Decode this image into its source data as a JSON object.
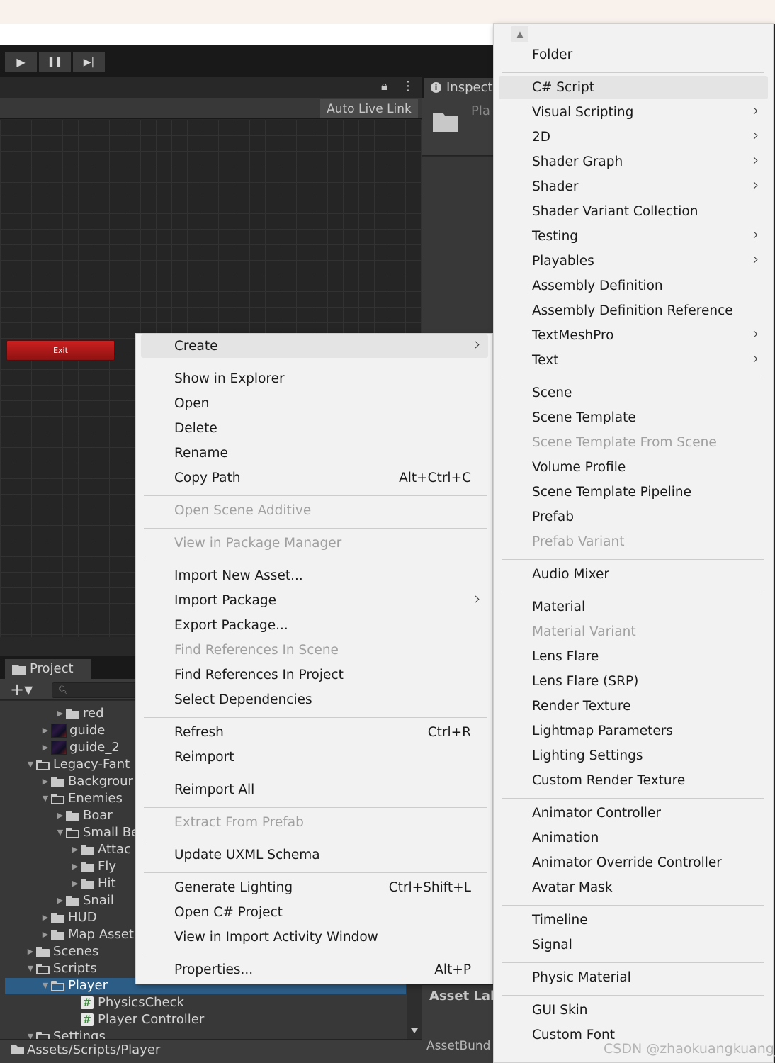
{
  "toolbar": {
    "play": "▶",
    "pause": "❚❚",
    "step": "▶|"
  },
  "scene": {
    "live_link": "Auto Live Link",
    "exit_button": "Exit"
  },
  "inspector": {
    "tab_label": "Inspect",
    "object_name": "Pla"
  },
  "project": {
    "tab_label": "Project",
    "plus": "+▾",
    "tree": [
      {
        "label": "red",
        "indent": 3,
        "icon": "folder",
        "expand": "collapsed"
      },
      {
        "label": "guide",
        "indent": 2,
        "icon": "image",
        "expand": "collapsed"
      },
      {
        "label": "guide_2",
        "indent": 2,
        "icon": "image",
        "expand": "collapsed"
      },
      {
        "label": "Legacy-Fant",
        "indent": 1,
        "icon": "folder-open",
        "expand": "expanded"
      },
      {
        "label": "Backgrour",
        "indent": 2,
        "icon": "folder",
        "expand": "collapsed"
      },
      {
        "label": "Enemies",
        "indent": 2,
        "icon": "folder-open",
        "expand": "expanded"
      },
      {
        "label": "Boar",
        "indent": 3,
        "icon": "folder",
        "expand": "collapsed"
      },
      {
        "label": "Small Be",
        "indent": 3,
        "icon": "folder-open",
        "expand": "expanded"
      },
      {
        "label": "Attac",
        "indent": 4,
        "icon": "folder",
        "expand": "collapsed"
      },
      {
        "label": "Fly",
        "indent": 4,
        "icon": "folder",
        "expand": "collapsed"
      },
      {
        "label": "Hit",
        "indent": 4,
        "icon": "folder",
        "expand": "collapsed"
      },
      {
        "label": "Snail",
        "indent": 3,
        "icon": "folder",
        "expand": "collapsed"
      },
      {
        "label": "HUD",
        "indent": 2,
        "icon": "folder",
        "expand": "collapsed"
      },
      {
        "label": "Map Asset",
        "indent": 2,
        "icon": "folder",
        "expand": "collapsed"
      },
      {
        "label": "Scenes",
        "indent": 1,
        "icon": "folder",
        "expand": "collapsed"
      },
      {
        "label": "Scripts",
        "indent": 1,
        "icon": "folder-open",
        "expand": "expanded"
      },
      {
        "label": "Player",
        "indent": 2,
        "icon": "folder-open",
        "expand": "expanded",
        "selected": true
      },
      {
        "label": "PhysicsCheck",
        "indent": 4,
        "icon": "script",
        "expand": "none"
      },
      {
        "label": "Player Controller",
        "indent": 4,
        "icon": "script",
        "expand": "none"
      },
      {
        "label": "Settings",
        "indent": 1,
        "icon": "folder-open",
        "expand": "expanded"
      }
    ],
    "path": "Assets/Scripts/Player",
    "asset_labels": "Asset Lab",
    "asset_bundle": "AssetBund"
  },
  "context_menu": {
    "items": [
      {
        "label": "Create",
        "submenu": true,
        "highlighted": true
      },
      {
        "sep": true
      },
      {
        "label": "Show in Explorer"
      },
      {
        "label": "Open"
      },
      {
        "label": "Delete"
      },
      {
        "label": "Rename"
      },
      {
        "label": "Copy Path",
        "shortcut": "Alt+Ctrl+C"
      },
      {
        "sep": true
      },
      {
        "label": "Open Scene Additive",
        "disabled": true
      },
      {
        "sep": true
      },
      {
        "label": "View in Package Manager",
        "disabled": true
      },
      {
        "sep": true
      },
      {
        "label": "Import New Asset..."
      },
      {
        "label": "Import Package",
        "submenu": true
      },
      {
        "label": "Export Package..."
      },
      {
        "label": "Find References In Scene",
        "disabled": true
      },
      {
        "label": "Find References In Project"
      },
      {
        "label": "Select Dependencies"
      },
      {
        "sep": true
      },
      {
        "label": "Refresh",
        "shortcut": "Ctrl+R"
      },
      {
        "label": "Reimport"
      },
      {
        "sep": true
      },
      {
        "label": "Reimport All"
      },
      {
        "sep": true
      },
      {
        "label": "Extract From Prefab",
        "disabled": true
      },
      {
        "sep": true
      },
      {
        "label": "Update UXML Schema"
      },
      {
        "sep": true
      },
      {
        "label": "Generate Lighting",
        "shortcut": "Ctrl+Shift+L"
      },
      {
        "label": "Open C# Project"
      },
      {
        "label": "View in Import Activity Window"
      },
      {
        "sep": true
      },
      {
        "label": "Properties...",
        "shortcut": "Alt+P"
      }
    ]
  },
  "create_submenu": {
    "items": [
      {
        "label": "Folder"
      },
      {
        "sep": true
      },
      {
        "label": "C# Script",
        "highlighted": true
      },
      {
        "label": "Visual Scripting",
        "submenu": true
      },
      {
        "label": "2D",
        "submenu": true
      },
      {
        "label": "Shader Graph",
        "submenu": true
      },
      {
        "label": "Shader",
        "submenu": true
      },
      {
        "label": "Shader Variant Collection"
      },
      {
        "label": "Testing",
        "submenu": true
      },
      {
        "label": "Playables",
        "submenu": true
      },
      {
        "label": "Assembly Definition"
      },
      {
        "label": "Assembly Definition Reference"
      },
      {
        "label": "TextMeshPro",
        "submenu": true
      },
      {
        "label": "Text",
        "submenu": true
      },
      {
        "sep": true
      },
      {
        "label": "Scene"
      },
      {
        "label": "Scene Template"
      },
      {
        "label": "Scene Template From Scene",
        "disabled": true
      },
      {
        "label": "Volume Profile"
      },
      {
        "label": "Scene Template Pipeline"
      },
      {
        "label": "Prefab"
      },
      {
        "label": "Prefab Variant",
        "disabled": true
      },
      {
        "sep": true
      },
      {
        "label": "Audio Mixer"
      },
      {
        "sep": true
      },
      {
        "label": "Material"
      },
      {
        "label": "Material Variant",
        "disabled": true
      },
      {
        "label": "Lens Flare"
      },
      {
        "label": "Lens Flare (SRP)"
      },
      {
        "label": "Render Texture"
      },
      {
        "label": "Lightmap Parameters"
      },
      {
        "label": "Lighting Settings"
      },
      {
        "label": "Custom Render Texture"
      },
      {
        "sep": true
      },
      {
        "label": "Animator Controller"
      },
      {
        "label": "Animation"
      },
      {
        "label": "Animator Override Controller"
      },
      {
        "label": "Avatar Mask"
      },
      {
        "sep": true
      },
      {
        "label": "Timeline"
      },
      {
        "label": "Signal"
      },
      {
        "sep": true
      },
      {
        "label": "Physic Material"
      },
      {
        "sep": true
      },
      {
        "label": "GUI Skin"
      },
      {
        "label": "Custom Font"
      }
    ]
  },
  "watermark": "CSDN @zhaokuangkuang_",
  "colors": {
    "selection": "#2c5d87",
    "menu_bg": "#f2f2f2",
    "exit_button": "#cc2020"
  }
}
